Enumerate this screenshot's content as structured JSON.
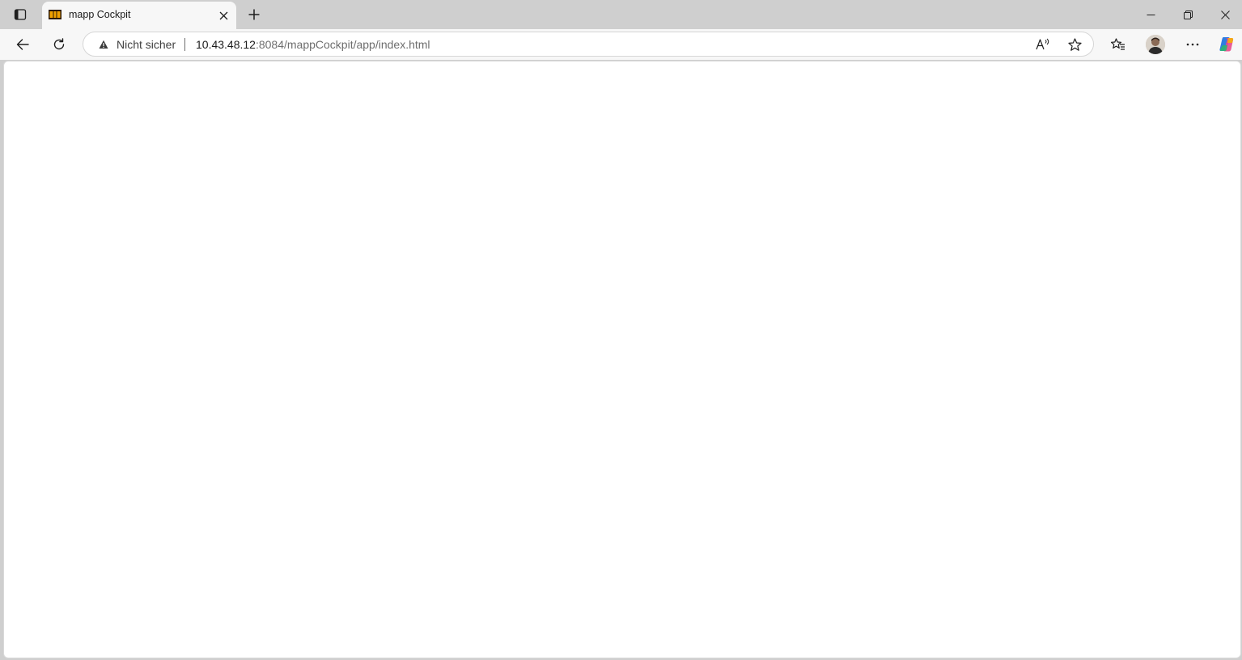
{
  "tab": {
    "title": "mapp Cockpit",
    "favicon": "mapp-logo-icon"
  },
  "address_bar": {
    "security_label": "Nicht sicher",
    "url_host": "10.43.48.12",
    "url_rest": ":8084/mappCockpit/app/index.html"
  },
  "toolbar_icons": [
    "tab-actions-icon",
    "back-arrow-icon",
    "reload-icon",
    "read-aloud-icon",
    "star-icon",
    "favorites-icon",
    "more-icon",
    "copilot-icon"
  ],
  "window_controls": [
    "minimize-icon",
    "restore-icon",
    "close-icon"
  ],
  "colors": {
    "frame": "#cfcfcf",
    "toolbar": "#f7f7f7",
    "page": "#ffffff",
    "favicon_orange": "#f0a000"
  }
}
